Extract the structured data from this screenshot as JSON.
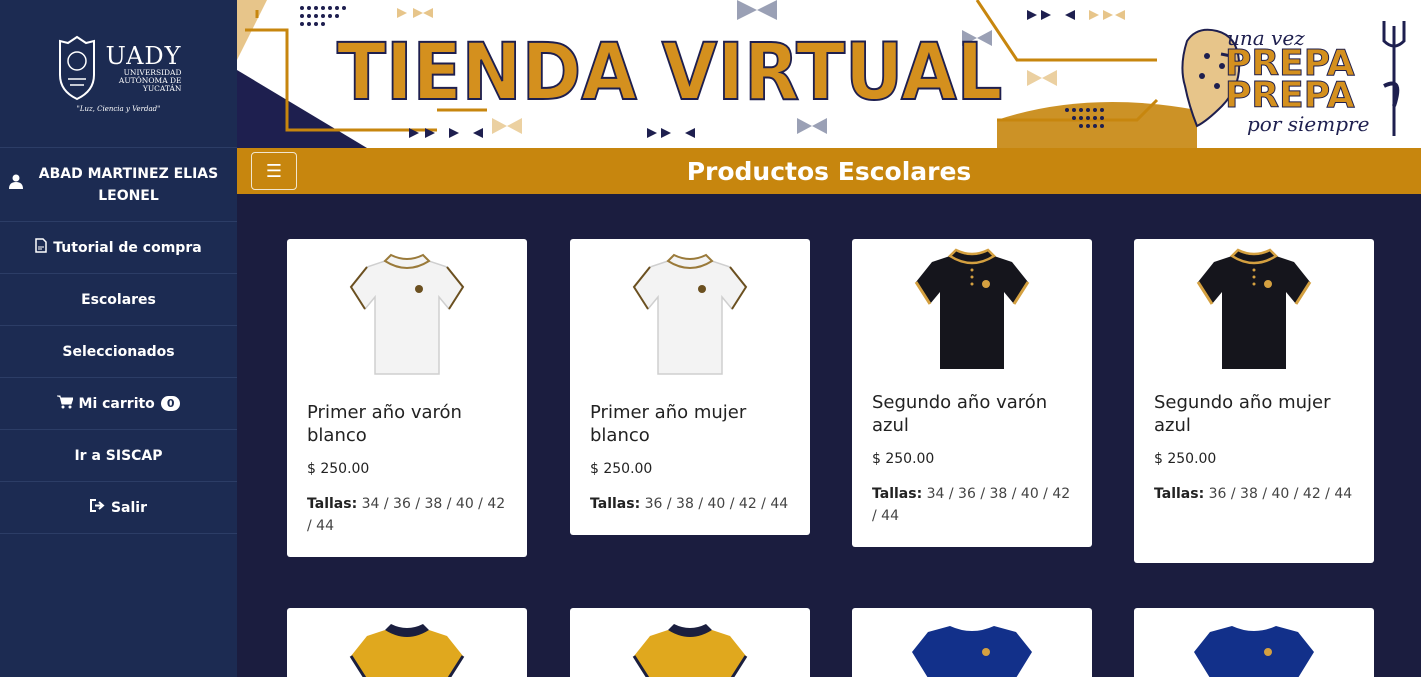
{
  "sidebar": {
    "logo": {
      "name": "UADY",
      "subtitle": "UNIVERSIDAD AUTÓNOMA DE YUCATÁN",
      "motto": "\"Luz, Ciencia y Verdad\""
    },
    "user": "ABAD MARTINEZ ELIAS LEONEL",
    "items": [
      {
        "label": "Tutorial de compra",
        "icon": "pdf-icon"
      },
      {
        "label": "Escolares"
      },
      {
        "label": "Seleccionados"
      },
      {
        "label": "Mi carrito",
        "icon": "cart-icon",
        "badge": "0"
      },
      {
        "label": "Ir a SISCAP"
      },
      {
        "label": "Salir",
        "icon": "logout-icon"
      }
    ]
  },
  "banner": {
    "title": "TIENDA VIRTUAL",
    "brand_small": "una vez",
    "brand_line1": "PREPA",
    "brand_line2": "PREPA",
    "brand_foot": "por siempre"
  },
  "titlebar": {
    "menu_icon": "hamburger-icon",
    "title": "Productos Escolares"
  },
  "colors": {
    "sidebar": "#1c2b52",
    "content_bg": "#1b1d3f",
    "accent": "#c7860e"
  },
  "products": [
    {
      "name": "Primer año varón blanco",
      "price": "$ 250.00",
      "sizes_label": "Tallas:",
      "sizes": "34 / 36 / 38 / 40 / 42 / 44",
      "shirt_color": "#f3f3f3"
    },
    {
      "name": "Primer año mujer blanco",
      "price": "$ 250.00",
      "sizes_label": "Tallas:",
      "sizes": "36 / 38 / 40 / 42 / 44",
      "shirt_color": "#f3f3f3"
    },
    {
      "name": "Segundo año varón azul",
      "price": "$ 250.00",
      "sizes_label": "Tallas:",
      "sizes": "34 / 36 / 38 / 40 / 42 / 44",
      "shirt_color": "#15151c"
    },
    {
      "name": "Segundo año mujer azul",
      "price": "$ 250.00",
      "sizes_label": "Tallas:",
      "sizes": "36 / 38 / 40 / 42 / 44",
      "shirt_color": "#15151c"
    }
  ],
  "products_row2_colors": [
    "#e0a81e",
    "#e0a81e",
    "#12308a",
    "#12308a"
  ]
}
